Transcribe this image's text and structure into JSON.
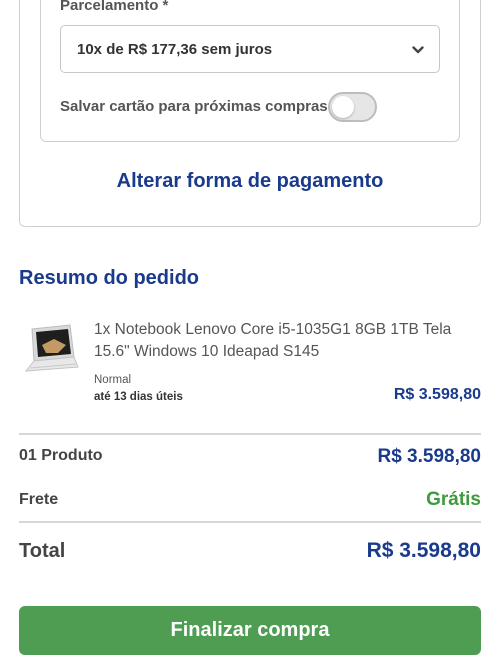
{
  "payment": {
    "installments_label": "Parcelamento *",
    "installments_value": "10x de R$ 177,36 sem juros",
    "save_card_label": "Salvar cartão para próximas compras",
    "save_card_enabled": false,
    "change_payment_label": "Alterar forma de pagamento"
  },
  "summary": {
    "title": "Resumo do pedido",
    "product": {
      "name": "1x Notebook Lenovo Core i5-1035G1 8GB 1TB Tela 15.6\" Windows 10 Ideapad S145",
      "shipping_type": "Normal",
      "shipping_time": "até 13 dias úteis",
      "price": "R$ 3.598,80"
    },
    "subtotal_label": "01 Produto",
    "subtotal_value": "R$ 3.598,80",
    "shipping_label": "Frete",
    "shipping_value": "Grátis",
    "total_label": "Total",
    "total_value": "R$ 3.598,80"
  },
  "finalize_label": "Finalizar compra",
  "colors": {
    "accent_blue": "#1a3a8c",
    "free_green": "#3f9a3f",
    "button_green": "#4e9d52"
  }
}
